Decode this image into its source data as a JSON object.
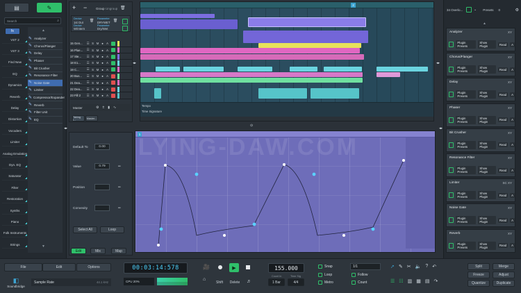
{
  "sidebar": {
    "search_placeholder": "Search",
    "categories": [
      "VST 2",
      "VST 3",
      "Find New",
      "EQ",
      "Dynamics",
      "Reverb",
      "Delay",
      "Distortion",
      "Vocoders",
      "Limiter",
      "Analog Emulation",
      "Dyn. EQ",
      "Saturator",
      "Filter",
      "Restoration",
      "Synths",
      "Piano",
      "Folk Instruments",
      "Strings"
    ],
    "effects": [
      "Analyzer",
      "Chorus/Flanger",
      "Delay",
      "Phaser",
      "Bit Crusher",
      "Resonance Filter",
      "Noise Gate",
      "Limiter",
      "Compressor/Expander",
      "Reverb",
      "Filter Unit",
      "EQ"
    ]
  },
  "tracks": {
    "toolbar": {
      "group_label": "Group",
      "ungroup_label": "Ungroup"
    },
    "device_label": "Device",
    "device_value": "1st Out",
    "device_value2": "W/Intern",
    "param_label": "Parameter",
    "param_value": "DRYWET",
    "param_value2": "Dry/Wet",
    "rows": [
      {
        "name": "15 Gen..."
      },
      {
        "name": "16 Plue..."
      },
      {
        "name": "17 Ste..."
      },
      {
        "name": "18 E1..."
      },
      {
        "name": "19 C..."
      },
      {
        "name": "20 Bus..."
      },
      {
        "name": "21 Dea..."
      },
      {
        "name": "22 Dea..."
      },
      {
        "name": "23 Fill 2"
      }
    ],
    "row_buttons": [
      "S",
      "M",
      "●",
      "A"
    ],
    "master_label": "Master",
    "tabs": [
      "Taking i...",
      "Master..."
    ]
  },
  "timeline": {
    "marker": "2",
    "tempo_label": "Tempo",
    "timesig_label": "Time Signature"
  },
  "automation": {
    "default_label": "Default To",
    "default_value": "0.00",
    "value_label": "Value",
    "value_value": "0.79",
    "position_label": "Position",
    "convexity_label": "Convexity",
    "select_all": "Select All",
    "loop": "Loop",
    "tabs": [
      "Edit",
      "Mix",
      "Map"
    ],
    "watermark": "FLYING-DAW.COM",
    "marker": "1"
  },
  "plugins": {
    "header_preset": "34 Overlo...",
    "presets_label": "Presets",
    "presets_value": "0",
    "slots": [
      {
        "name": "Analyzer",
        "x": "XY"
      },
      {
        "name": "Chorus/Flanger",
        "x": "XY"
      },
      {
        "name": "Delay",
        "x": "XY"
      },
      {
        "name": "Phaser",
        "x": "XY"
      },
      {
        "name": "Bit Crusher",
        "x": "XY"
      },
      {
        "name": "Resonance Filter",
        "x": "XY"
      },
      {
        "name": "Limiter",
        "x": "SC XY"
      },
      {
        "name": "Noise Gate",
        "x": "XY"
      },
      {
        "name": "Reverb",
        "x": "XY"
      }
    ],
    "row_labels": {
      "presets": "Plugin Presets",
      "show": "Show Plugin",
      "read": "Read",
      "a": "A"
    }
  },
  "transport": {
    "file": "File",
    "edit": "Edit",
    "options": "Options",
    "logo": "Soundbridge",
    "sample_rate_label": "Sample Rate",
    "sample_rate_value": "44.1 kHz",
    "time": "00:03:14:578",
    "cpu": "CPU 20%",
    "tempo": "155.000",
    "count_in_label": "Count In",
    "count_in_value": "1 Bar",
    "time_sig_label": "Time Sig",
    "time_sig_value": "4/4",
    "snap": "Snap",
    "loop": "Loop",
    "metro": "Metro",
    "snap_value": "1/1",
    "follow": "Follow",
    "count": "Count",
    "edit_buttons": [
      "Shift",
      "Delete"
    ],
    "right_buttons": [
      "Split",
      "Merge",
      "Freeze",
      "Adjust",
      "Quantize",
      "Duplicate"
    ]
  }
}
